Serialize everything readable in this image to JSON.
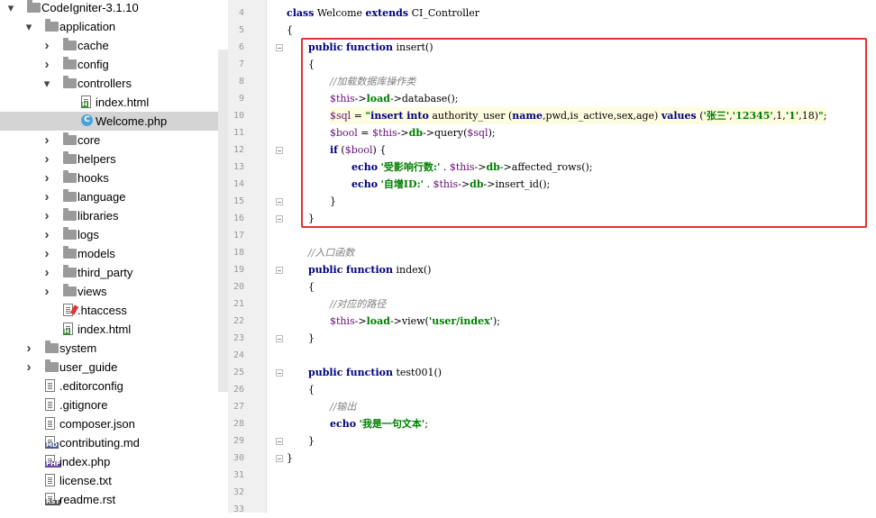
{
  "tree": {
    "items": [
      {
        "label": "CodeIgniter-3.1.10",
        "kind": "folder",
        "depth": 0,
        "expanded": true
      },
      {
        "label": "application",
        "kind": "folder",
        "depth": 1,
        "expanded": true
      },
      {
        "label": "cache",
        "kind": "folder",
        "depth": 2,
        "expanded": false
      },
      {
        "label": "config",
        "kind": "folder",
        "depth": 2,
        "expanded": false
      },
      {
        "label": "controllers",
        "kind": "folder",
        "depth": 2,
        "expanded": true
      },
      {
        "label": "index.html",
        "kind": "file-html",
        "depth": 3
      },
      {
        "label": "Welcome.php",
        "kind": "file-class",
        "depth": 3,
        "selected": true
      },
      {
        "label": "core",
        "kind": "folder",
        "depth": 2,
        "expanded": false
      },
      {
        "label": "helpers",
        "kind": "folder",
        "depth": 2,
        "expanded": false
      },
      {
        "label": "hooks",
        "kind": "folder",
        "depth": 2,
        "expanded": false
      },
      {
        "label": "language",
        "kind": "folder",
        "depth": 2,
        "expanded": false
      },
      {
        "label": "libraries",
        "kind": "folder",
        "depth": 2,
        "expanded": false
      },
      {
        "label": "logs",
        "kind": "folder",
        "depth": 2,
        "expanded": false
      },
      {
        "label": "models",
        "kind": "folder",
        "depth": 2,
        "expanded": false
      },
      {
        "label": "third_party",
        "kind": "folder",
        "depth": 2,
        "expanded": false
      },
      {
        "label": "views",
        "kind": "folder",
        "depth": 2,
        "expanded": false
      },
      {
        "label": ".htaccess",
        "kind": "file-htaccess",
        "depth": 2
      },
      {
        "label": "index.html",
        "kind": "file-html",
        "depth": 2
      },
      {
        "label": "system",
        "kind": "folder",
        "depth": 1,
        "expanded": false
      },
      {
        "label": "user_guide",
        "kind": "folder",
        "depth": 1,
        "expanded": false
      },
      {
        "label": ".editorconfig",
        "kind": "file-generic",
        "depth": 1
      },
      {
        "label": ".gitignore",
        "kind": "file-generic",
        "depth": 1
      },
      {
        "label": "composer.json",
        "kind": "file-generic",
        "depth": 1
      },
      {
        "label": "contributing.md",
        "kind": "file-md",
        "depth": 1
      },
      {
        "label": "index.php",
        "kind": "file-php",
        "depth": 1
      },
      {
        "label": "license.txt",
        "kind": "file-generic",
        "depth": 1
      },
      {
        "label": "readme.rst",
        "kind": "file-rst",
        "depth": 1
      }
    ]
  },
  "editor": {
    "lines": [
      {
        "n": "4",
        "indent": 0,
        "tokens": [
          [
            "kw",
            "class"
          ],
          [
            "t",
            " Welcome "
          ],
          [
            "kw",
            "extends"
          ],
          [
            "t",
            " CI_Controller"
          ]
        ]
      },
      {
        "n": "5",
        "indent": 0,
        "tokens": [
          [
            "t",
            "{"
          ]
        ]
      },
      {
        "n": "6",
        "indent": 1,
        "fold": true,
        "tokens": [
          [
            "kw",
            "public"
          ],
          [
            "t",
            " "
          ],
          [
            "kw",
            "function"
          ],
          [
            "t",
            " insert()"
          ]
        ]
      },
      {
        "n": "7",
        "indent": 1,
        "tokens": [
          [
            "t",
            "{"
          ]
        ]
      },
      {
        "n": "8",
        "indent": 2,
        "tokens": [
          [
            "cmt",
            "//加载数据库操作类"
          ]
        ]
      },
      {
        "n": "9",
        "indent": 2,
        "tokens": [
          [
            "var",
            "$this"
          ],
          [
            "t",
            "->"
          ],
          [
            "str",
            "load"
          ],
          [
            "t",
            "->database();"
          ]
        ]
      },
      {
        "n": "10",
        "indent": 2,
        "hl": true,
        "tokens": [
          [
            "var",
            "$sql"
          ],
          [
            "t",
            " = "
          ],
          [
            "str",
            "\""
          ],
          [
            "kw",
            "insert into"
          ],
          [
            "t",
            " authority_user ("
          ],
          [
            "kw",
            "name"
          ],
          [
            "t",
            ",pwd,is_active,sex,age) "
          ],
          [
            "kw",
            "values"
          ],
          [
            "t",
            " ("
          ],
          [
            "str",
            "'张三'"
          ],
          [
            "t",
            ","
          ],
          [
            "str",
            "'12345'"
          ],
          [
            "t",
            ",1,"
          ],
          [
            "str",
            "'1'"
          ],
          [
            "t",
            ",18)"
          ],
          [
            "str",
            "\""
          ],
          [
            "t",
            ";"
          ]
        ]
      },
      {
        "n": "11",
        "indent": 2,
        "tokens": [
          [
            "var",
            "$bool"
          ],
          [
            "t",
            " = "
          ],
          [
            "var",
            "$this"
          ],
          [
            "t",
            "->"
          ],
          [
            "str",
            "db"
          ],
          [
            "t",
            "->query("
          ],
          [
            "var",
            "$sql"
          ],
          [
            "t",
            ");"
          ]
        ]
      },
      {
        "n": "12",
        "indent": 2,
        "fold": true,
        "tokens": [
          [
            "kw",
            "if"
          ],
          [
            "t",
            " ("
          ],
          [
            "var",
            "$bool"
          ],
          [
            "t",
            ") {"
          ]
        ]
      },
      {
        "n": "13",
        "indent": 3,
        "tokens": [
          [
            "kw",
            "echo"
          ],
          [
            "t",
            " "
          ],
          [
            "str",
            "'受影响行数:'"
          ],
          [
            "t",
            " . "
          ],
          [
            "var",
            "$this"
          ],
          [
            "t",
            "->"
          ],
          [
            "str",
            "db"
          ],
          [
            "t",
            "->affected_rows();"
          ]
        ]
      },
      {
        "n": "14",
        "indent": 3,
        "tokens": [
          [
            "kw",
            "echo"
          ],
          [
            "t",
            " "
          ],
          [
            "str",
            "'自增ID:'"
          ],
          [
            "t",
            " . "
          ],
          [
            "var",
            "$this"
          ],
          [
            "t",
            "->"
          ],
          [
            "str",
            "db"
          ],
          [
            "t",
            "->insert_id();"
          ]
        ]
      },
      {
        "n": "15",
        "indent": 2,
        "fold": true,
        "tokens": [
          [
            "t",
            "}"
          ]
        ]
      },
      {
        "n": "16",
        "indent": 1,
        "fold": true,
        "tokens": [
          [
            "t",
            "}"
          ]
        ]
      },
      {
        "n": "17",
        "indent": 0,
        "tokens": []
      },
      {
        "n": "18",
        "indent": 1,
        "tokens": [
          [
            "cmt",
            "//入口函数"
          ]
        ]
      },
      {
        "n": "19",
        "indent": 1,
        "fold": true,
        "tokens": [
          [
            "kw",
            "public"
          ],
          [
            "t",
            " "
          ],
          [
            "kw",
            "function"
          ],
          [
            "t",
            " index()"
          ]
        ]
      },
      {
        "n": "20",
        "indent": 1,
        "tokens": [
          [
            "t",
            "{"
          ]
        ]
      },
      {
        "n": "21",
        "indent": 2,
        "tokens": [
          [
            "cmt",
            "//对应的路径"
          ]
        ]
      },
      {
        "n": "22",
        "indent": 2,
        "tokens": [
          [
            "var",
            "$this"
          ],
          [
            "t",
            "->"
          ],
          [
            "str",
            "load"
          ],
          [
            "t",
            "->view("
          ],
          [
            "str",
            "'user/index'"
          ],
          [
            "t",
            ");"
          ]
        ]
      },
      {
        "n": "23",
        "indent": 1,
        "fold": true,
        "tokens": [
          [
            "t",
            "}"
          ]
        ]
      },
      {
        "n": "24",
        "indent": 0,
        "tokens": []
      },
      {
        "n": "25",
        "indent": 1,
        "fold": true,
        "tokens": [
          [
            "kw",
            "public"
          ],
          [
            "t",
            " "
          ],
          [
            "kw",
            "function"
          ],
          [
            "t",
            " test001()"
          ]
        ]
      },
      {
        "n": "26",
        "indent": 1,
        "tokens": [
          [
            "t",
            "{"
          ]
        ]
      },
      {
        "n": "27",
        "indent": 2,
        "tokens": [
          [
            "cmt",
            "//输出"
          ]
        ]
      },
      {
        "n": "28",
        "indent": 2,
        "tokens": [
          [
            "kw",
            "echo"
          ],
          [
            "t",
            " "
          ],
          [
            "str",
            "'我是一句文本'"
          ],
          [
            "t",
            ";"
          ]
        ]
      },
      {
        "n": "29",
        "indent": 1,
        "fold": true,
        "tokens": [
          [
            "t",
            "}"
          ]
        ]
      },
      {
        "n": "30",
        "indent": 0,
        "fold": true,
        "tokens": [
          [
            "t",
            "}"
          ]
        ]
      },
      {
        "n": "31",
        "indent": 0,
        "tokens": []
      },
      {
        "n": "32",
        "indent": 0,
        "tokens": []
      },
      {
        "n": "33",
        "indent": 0,
        "tokens": []
      }
    ]
  }
}
